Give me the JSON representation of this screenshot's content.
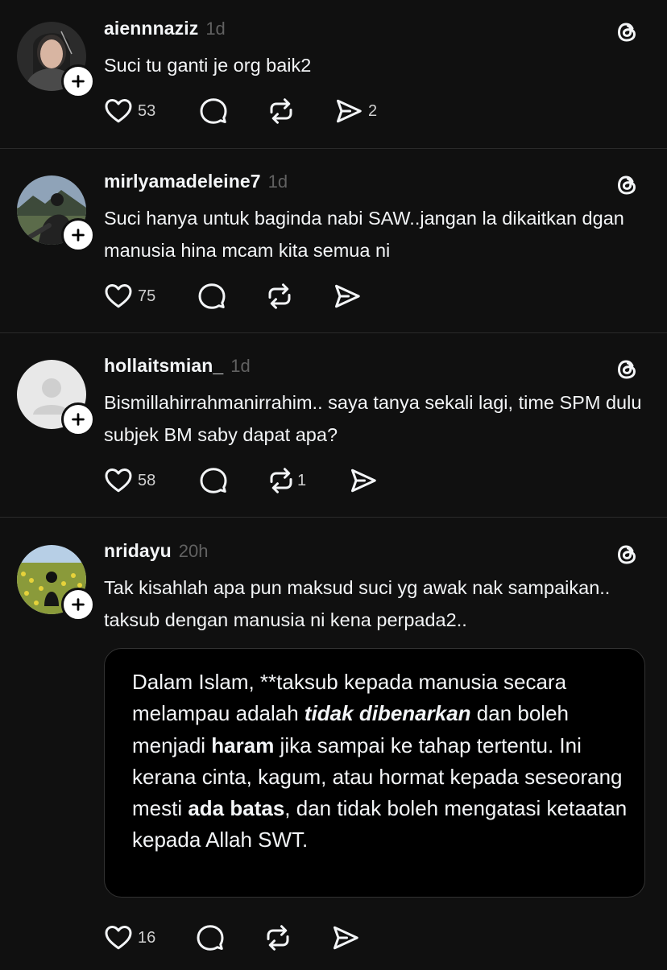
{
  "posts": [
    {
      "username": "aiennnaziz",
      "time": "1d",
      "text": "Suci tu ganti je org baik2",
      "likes": "53",
      "shares": "2"
    },
    {
      "username": "mirlyamadeleine7",
      "time": "1d",
      "text": "Suci hanya untuk baginda nabi SAW..jangan la dikaitkan dgan manusia hina mcam kita semua ni",
      "likes": "75"
    },
    {
      "username": "hollaitsmian_",
      "time": "1d",
      "text": "Bismillahirrahmanirrahim.. saya tanya sekali lagi, time SPM dulu subjek BM saby dapat apa?",
      "likes": "58",
      "reposts": "1"
    },
    {
      "username": "nridayu",
      "time": "20h",
      "text": "Tak kisahlah apa pun maksud suci yg awak nak sampaikan.. taksub dengan manusia ni kena perpada2..",
      "likes": "16",
      "quote": {
        "part1": "Dalam Islam, **taksub kepada manusia secara melampau adalah ",
        "bold1": "tidak dibenarkan",
        "part2": " dan boleh menjadi ",
        "bold2": "haram",
        "part3": " jika sampai ke tahap tertentu. Ini kerana cinta, kagum, atau hormat kepada seseorang mesti ",
        "bold3": "ada batas",
        "part4": ", dan tidak boleh mengatasi ketaatan kepada Allah SWT."
      }
    }
  ],
  "icons": {
    "like": "heart-icon",
    "reply": "comment-icon",
    "repost": "repost-icon",
    "share": "send-icon",
    "threads": "threads-logo-icon",
    "follow": "plus-icon"
  }
}
